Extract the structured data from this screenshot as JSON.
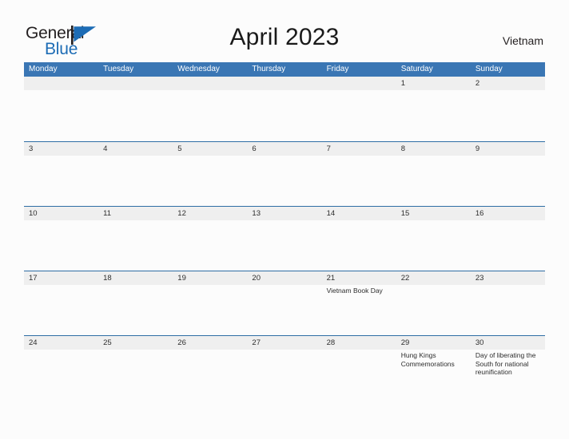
{
  "brand": {
    "name_part1": "General",
    "name_part2": "Blue",
    "flag_icon": "blue-triangle-flag-icon",
    "color_dark": "#231f20",
    "color_blue": "#1d6cb5"
  },
  "header": {
    "title": "April 2023",
    "country": "Vietnam"
  },
  "theme": {
    "header_blue": "#3a76b4",
    "row_border_blue": "#2e6da4",
    "date_band_gray": "#efefef",
    "page_background": "#fcfcfc"
  },
  "calendar": {
    "weekdays": [
      "Monday",
      "Tuesday",
      "Wednesday",
      "Thursday",
      "Friday",
      "Saturday",
      "Sunday"
    ],
    "weeks": [
      [
        {
          "date": "",
          "events": []
        },
        {
          "date": "",
          "events": []
        },
        {
          "date": "",
          "events": []
        },
        {
          "date": "",
          "events": []
        },
        {
          "date": "",
          "events": []
        },
        {
          "date": "1",
          "events": []
        },
        {
          "date": "2",
          "events": []
        }
      ],
      [
        {
          "date": "3",
          "events": []
        },
        {
          "date": "4",
          "events": []
        },
        {
          "date": "5",
          "events": []
        },
        {
          "date": "6",
          "events": []
        },
        {
          "date": "7",
          "events": []
        },
        {
          "date": "8",
          "events": []
        },
        {
          "date": "9",
          "events": []
        }
      ],
      [
        {
          "date": "10",
          "events": []
        },
        {
          "date": "11",
          "events": []
        },
        {
          "date": "12",
          "events": []
        },
        {
          "date": "13",
          "events": []
        },
        {
          "date": "14",
          "events": []
        },
        {
          "date": "15",
          "events": []
        },
        {
          "date": "16",
          "events": []
        }
      ],
      [
        {
          "date": "17",
          "events": []
        },
        {
          "date": "18",
          "events": []
        },
        {
          "date": "19",
          "events": []
        },
        {
          "date": "20",
          "events": []
        },
        {
          "date": "21",
          "events": [
            "Vietnam Book Day"
          ]
        },
        {
          "date": "22",
          "events": []
        },
        {
          "date": "23",
          "events": []
        }
      ],
      [
        {
          "date": "24",
          "events": []
        },
        {
          "date": "25",
          "events": []
        },
        {
          "date": "26",
          "events": []
        },
        {
          "date": "27",
          "events": []
        },
        {
          "date": "28",
          "events": []
        },
        {
          "date": "29",
          "events": [
            "Hung Kings Commemorations"
          ]
        },
        {
          "date": "30",
          "events": [
            "Day of liberating the South for national reunification"
          ]
        }
      ]
    ]
  }
}
